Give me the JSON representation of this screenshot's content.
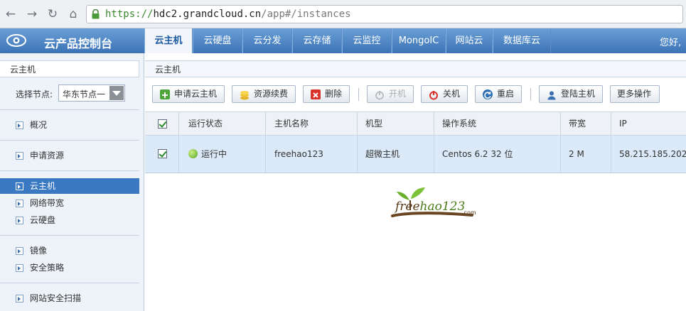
{
  "browser": {
    "url_proto": "https://",
    "url_host": "hdc2.grandcloud.cn",
    "url_path": "/app#/instances"
  },
  "header": {
    "app_title": "云产品控制台",
    "tabs": [
      {
        "label": "云主机",
        "active": true
      },
      {
        "label": "云硬盘"
      },
      {
        "label": "云分发"
      },
      {
        "label": "云存储"
      },
      {
        "label": "云监控"
      },
      {
        "label": "MongoIC"
      },
      {
        "label": "网站云"
      },
      {
        "label": "数据库云"
      }
    ],
    "greeting": "您好,"
  },
  "sidebar": {
    "title": "云主机",
    "node_label": "选择节点:",
    "node_value": "华东节点一",
    "items": [
      {
        "label": "概况"
      },
      {
        "label": "申请资源"
      },
      {
        "label": "云主机",
        "active": true
      },
      {
        "label": "网络带宽"
      },
      {
        "label": "云硬盘"
      },
      {
        "label": "镜像"
      },
      {
        "label": "安全策略"
      },
      {
        "label": "网站安全扫描"
      }
    ]
  },
  "main": {
    "breadcrumb": "云主机",
    "toolbar": {
      "apply": "申请云主机",
      "renew": "资源续费",
      "delete": "删除",
      "start": "开机",
      "shutdown": "关机",
      "restart": "重启",
      "login": "登陆主机",
      "more": "更多操作"
    },
    "table": {
      "headers": [
        "运行状态",
        "主机名称",
        "机型",
        "操作系统",
        "带宽",
        "IP"
      ],
      "rows": [
        {
          "status": "运行中",
          "name": "freehao123",
          "type": "超微主机",
          "os": "Centos 6.2 32 位",
          "bandwidth": "2 M",
          "ip": "58.215.185.202"
        }
      ]
    },
    "watermark": {
      "brand": "freehao123",
      "tld": ".com"
    }
  },
  "colors": {
    "accent": "#3a79c1",
    "header": "#4c82c2",
    "running": "#5aa51d"
  }
}
